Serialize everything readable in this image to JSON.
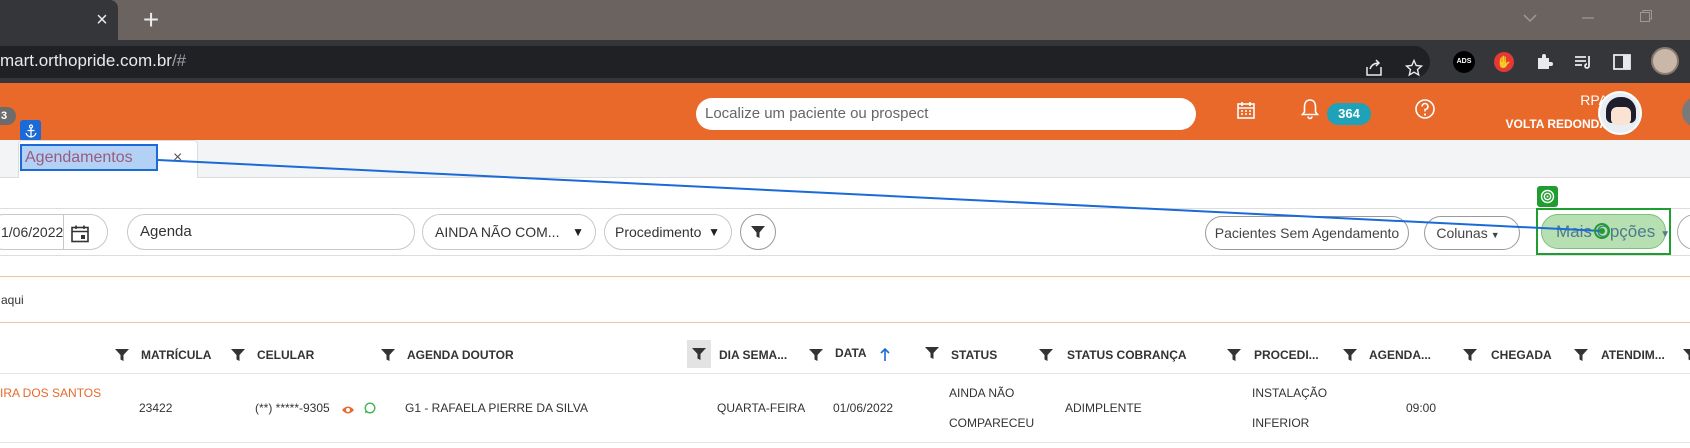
{
  "browser": {
    "url_main": "mart.orthopride.com.br",
    "url_rest": "/#",
    "tab_close": "×",
    "new_tab": "+"
  },
  "header": {
    "left_badge": "3",
    "search_placeholder": "Localize um paciente ou prospect",
    "notification_count": "364",
    "user_name": "RPA",
    "user_unit": "VOLTA REDONDA",
    "accent": "#e8692a"
  },
  "app_tabs": [
    {
      "label": "Agendamentos",
      "close": "×"
    }
  ],
  "filters": {
    "date": "1/06/2022",
    "agenda": "Agenda",
    "status": "AINDA NÃO COM...",
    "procedure": "Procedimento",
    "pacientes_sem_agendamento": "Pacientes Sem Agendamento",
    "colunas": "Colunas",
    "mais_opcoes": "Mais Opções"
  },
  "notice": "aqui",
  "table": {
    "columns": [
      "MATRÍCULA",
      "CELULAR",
      "AGENDA DOUTOR",
      "DIA SEMA...",
      "DATA",
      "STATUS",
      "STATUS COBRANÇA",
      "PROCEDI...",
      "AGENDA...",
      "CHEGADA",
      "ATENDIM..."
    ],
    "rows": [
      {
        "name": "IRA DOS SANTOS",
        "matricula": "23422",
        "celular": "(**) *****-9305",
        "agenda_doutor": "G1 - RAFAELA PIERRE DA SILVA",
        "dia_semana": "QUARTA-FEIRA",
        "data": "01/06/2022",
        "status_l1": "AINDA NÃO",
        "status_l2": "COMPARECEU",
        "status_cobranca": "ADIMPLENTE",
        "procedimento_l1": "INSTALAÇÃO",
        "procedimento_l2": "INFERIOR",
        "agenda_hora": "09:00"
      }
    ]
  }
}
